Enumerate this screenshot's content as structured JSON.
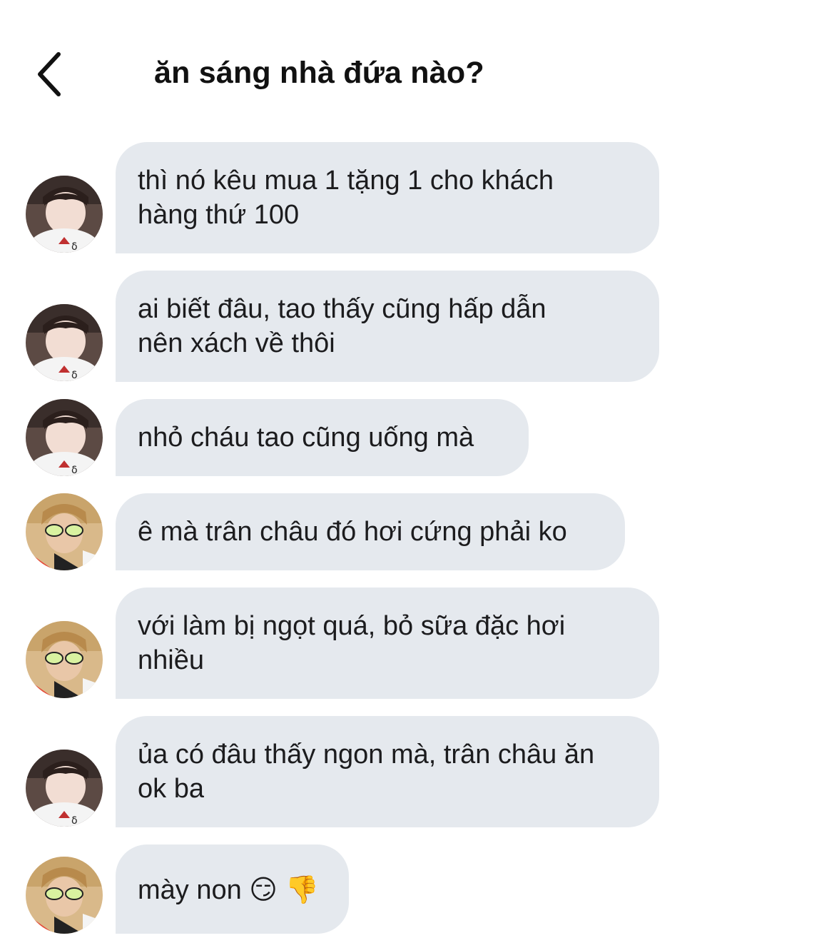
{
  "header": {
    "title": "ăn sáng nhà đứa nào?",
    "back_icon": "chevron-left-icon"
  },
  "colors": {
    "bubble_background": "#e5e9ee",
    "text": "#1c1c1e"
  },
  "messages": [
    {
      "sender": "avatar-a",
      "text": "thì nó kêu mua 1 tặng 1 cho khách\nhàng thứ 100"
    },
    {
      "sender": "avatar-a",
      "text": "ai biết đâu, tao thấy cũng hấp dẫn\nnên xách về thôi"
    },
    {
      "sender": "avatar-a",
      "text": "nhỏ cháu tao cũng uống mà"
    },
    {
      "sender": "avatar-b",
      "text": "ê mà trân châu đó hơi cứng phải ko"
    },
    {
      "sender": "avatar-b",
      "text": "với làm bị ngọt quá, bỏ sữa đặc hơi\nnhiều"
    },
    {
      "sender": "avatar-a",
      "text": "ủa có đâu thấy ngon mà, trân châu ăn\nok ba"
    },
    {
      "sender": "avatar-b",
      "text": "mày non 😏 👎"
    }
  ]
}
